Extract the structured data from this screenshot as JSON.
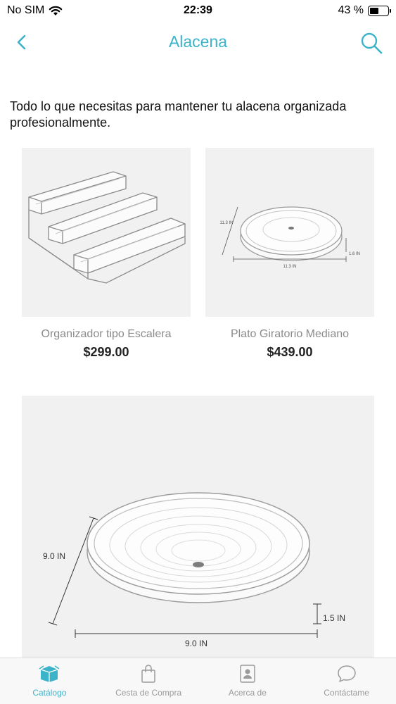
{
  "status_bar": {
    "carrier": "No SIM",
    "time": "22:39",
    "battery": "43 %",
    "battery_level": 0.43
  },
  "nav": {
    "title": "Alacena",
    "back_icon": "chevron-left-icon",
    "search_icon": "search-icon"
  },
  "intro_text": "Todo lo que necesitas para mantener tu alacena organizada profesionalmente.",
  "products": [
    {
      "name": "Organizador tipo Escalera",
      "price": "$299.00"
    },
    {
      "name": "Plato Giratorio Mediano",
      "price": "$439.00"
    },
    {
      "name": "",
      "price": ""
    }
  ],
  "product_dims": {
    "medium": {
      "width": "11.3 IN",
      "depth": "11.3 IN",
      "height": "1.6 IN"
    },
    "large": {
      "width": "9.0 IN",
      "depth": "9.0 IN",
      "height": "1.5 IN"
    }
  },
  "tab_bar": {
    "active_color": "#3db3c9",
    "items": [
      {
        "label": "Catálogo",
        "icon": "box-icon",
        "active": true
      },
      {
        "label": "Cesta de Compra",
        "icon": "shopping-bag-icon",
        "active": false
      },
      {
        "label": "Acerca de",
        "icon": "contact-card-icon",
        "active": false
      },
      {
        "label": "Contáctame",
        "icon": "chat-bubble-icon",
        "active": false
      }
    ]
  }
}
